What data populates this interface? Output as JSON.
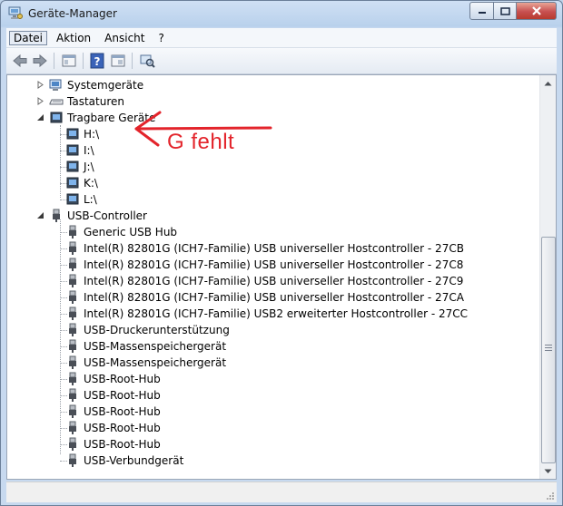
{
  "window": {
    "title": "Geräte-Manager",
    "title_icon": "device-manager-icon"
  },
  "menu": [
    "Datei",
    "Aktion",
    "Ansicht",
    "?"
  ],
  "toolbar": {
    "icons": [
      "back-arrow-icon",
      "forward-arrow-icon",
      "properties-window-icon",
      "help-icon",
      "view-panel-icon",
      "scan-hardware-icon"
    ]
  },
  "tree": {
    "systemgeraete": "Systemgeräte",
    "tastaturen": "Tastaturen",
    "tragbare": "Tragbare Geräte",
    "drives": [
      "H:\\",
      "I:\\",
      "J:\\",
      "K:\\",
      "L:\\"
    ],
    "usb_controller": "USB-Controller",
    "usb_items": [
      "Generic USB Hub",
      "Intel(R) 82801G (ICH7-Familie) USB universeller Hostcontroller - 27CB",
      "Intel(R) 82801G (ICH7-Familie) USB universeller Hostcontroller - 27C8",
      "Intel(R) 82801G (ICH7-Familie) USB universeller Hostcontroller - 27C9",
      "Intel(R) 82801G (ICH7-Familie) USB universeller Hostcontroller - 27CA",
      "Intel(R) 82801G (ICH7-Familie) USB2 erweiterter Hostcontroller - 27CC",
      "USB-Druckerunterstützung",
      "USB-Massenspeichergerät",
      "USB-Massenspeichergerät",
      "USB-Root-Hub",
      "USB-Root-Hub",
      "USB-Root-Hub",
      "USB-Root-Hub",
      "USB-Root-Hub",
      "USB-Verbundgerät"
    ]
  },
  "annotation": {
    "text": "G fehlt",
    "color": "#e3242b"
  },
  "colors": {
    "accent": "#e3242b",
    "titlebar": "#b9d1ec"
  }
}
